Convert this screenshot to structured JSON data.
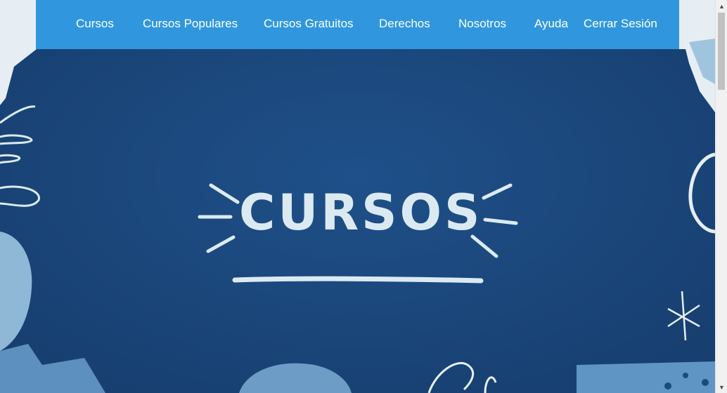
{
  "nav": {
    "items": [
      {
        "label": "Cursos"
      },
      {
        "label": "Cursos Populares"
      },
      {
        "label": "Cursos Gratuitos"
      },
      {
        "label": "Derechos"
      },
      {
        "label": "Nosotros"
      },
      {
        "label": "Ayuda"
      },
      {
        "label": "Cerrar Sesión"
      }
    ]
  },
  "hero": {
    "title": "CURSOS"
  },
  "colors": {
    "nav_bg": "#3097de",
    "hero_bg": "#1c4a80",
    "hero_text": "#dbeaf2"
  }
}
